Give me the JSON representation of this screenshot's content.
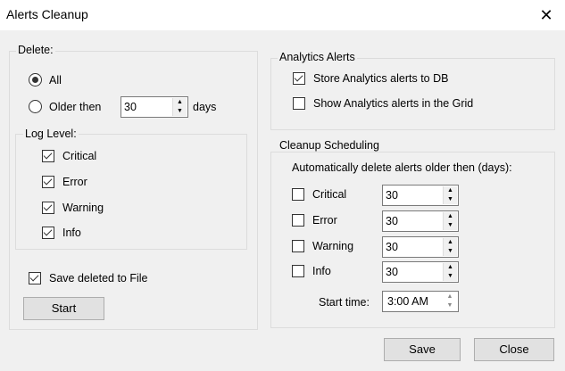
{
  "window": {
    "title": "Alerts Cleanup",
    "close_glyph": "✕"
  },
  "delete": {
    "label": "Delete:",
    "all": "All",
    "older": "Older then",
    "days_value": "30",
    "days_unit": "days"
  },
  "log_level": {
    "label": "Log Level:",
    "items": [
      {
        "label": "Critical",
        "checked": true
      },
      {
        "label": "Error",
        "checked": true
      },
      {
        "label": "Warning",
        "checked": true
      },
      {
        "label": "Info",
        "checked": true
      }
    ]
  },
  "save_to_file": {
    "label": "Save deleted to File",
    "checked": true
  },
  "start_button": "Start",
  "analytics": {
    "label": "Analytics Alerts",
    "store": "Store Analytics alerts to DB",
    "show": "Show Analytics alerts in the Grid"
  },
  "scheduling": {
    "label": "Cleanup Scheduling",
    "desc": "Automatically delete alerts older then (days):",
    "items": [
      {
        "label": "Critical",
        "value": "30"
      },
      {
        "label": "Error",
        "value": "30"
      },
      {
        "label": "Warning",
        "value": "30"
      },
      {
        "label": "Info",
        "value": "30"
      }
    ],
    "start_time_label": "Start time:",
    "start_time": "3:00 AM"
  },
  "buttons": {
    "save": "Save",
    "close": "Close"
  }
}
